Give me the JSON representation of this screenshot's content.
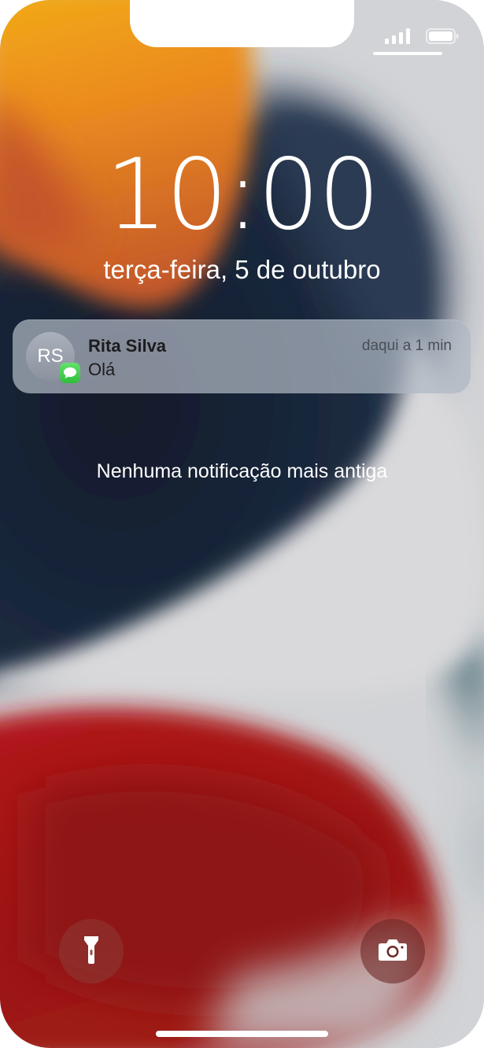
{
  "lockscreen": {
    "time": "10:00",
    "date": "terça-feira, 5 de outubro",
    "no_older_notifications": "Nenhuma notificação mais antiga"
  },
  "status_bar": {
    "icons": [
      "signal-icon",
      "battery-icon"
    ]
  },
  "notification": {
    "avatar_initials": "RS",
    "sender": "Rita Silva",
    "message": "Olá",
    "time": "daqui a 1 min",
    "app_icon": "messages-icon"
  },
  "quick_actions": {
    "left_icon": "flashlight-icon",
    "right_icon": "camera-icon"
  },
  "colors": {
    "messages_green": "#34c759",
    "notification_bg": "#b0b8c4"
  }
}
